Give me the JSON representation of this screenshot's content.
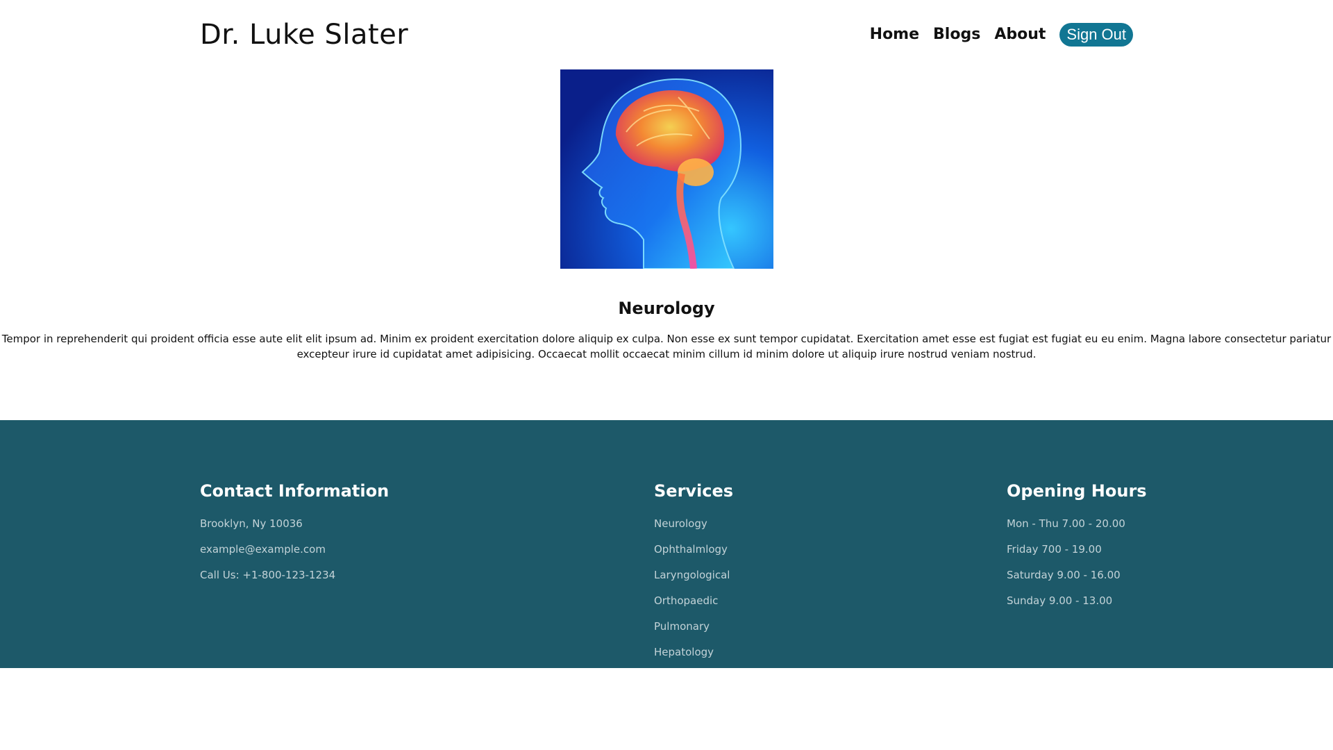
{
  "header": {
    "brand": "Dr. Luke Slater",
    "nav": {
      "home": "Home",
      "blogs": "Blogs",
      "about": "About",
      "sign_out": "Sign Out"
    }
  },
  "main": {
    "image_icon": "brain-scan-image",
    "title": "Neurology",
    "description": "Tempor in reprehenderit qui proident officia esse aute elit elit ipsum ad. Minim ex proident exercitation dolore aliquip ex culpa. Non esse ex sunt tempor cupidatat. Exercitation amet esse est fugiat est fugiat eu eu enim. Magna labore consectetur pariatur excepteur irure id cupidatat amet adipisicing. Occaecat mollit occaecat minim cillum id minim dolore ut aliquip irure nostrud veniam nostrud."
  },
  "footer": {
    "background_color": "#1d5969",
    "contact": {
      "heading": "Contact Information",
      "items": [
        "Brooklyn, Ny 10036",
        "example@example.com",
        "Call Us: +1-800-123-1234"
      ]
    },
    "services": {
      "heading": "Services",
      "items": [
        "Neurology",
        "Ophthalmlogy",
        "Laryngological",
        "Orthopaedic",
        "Pulmonary",
        "Hepatology"
      ]
    },
    "hours": {
      "heading": "Opening Hours",
      "items": [
        "Mon - Thu 7.00 - 20.00",
        "Friday 700 - 19.00",
        "Saturday 9.00 - 16.00",
        "Sunday 9.00 - 13.00"
      ]
    }
  },
  "colors": {
    "accent": "#117693",
    "footer": "#1d5969"
  }
}
